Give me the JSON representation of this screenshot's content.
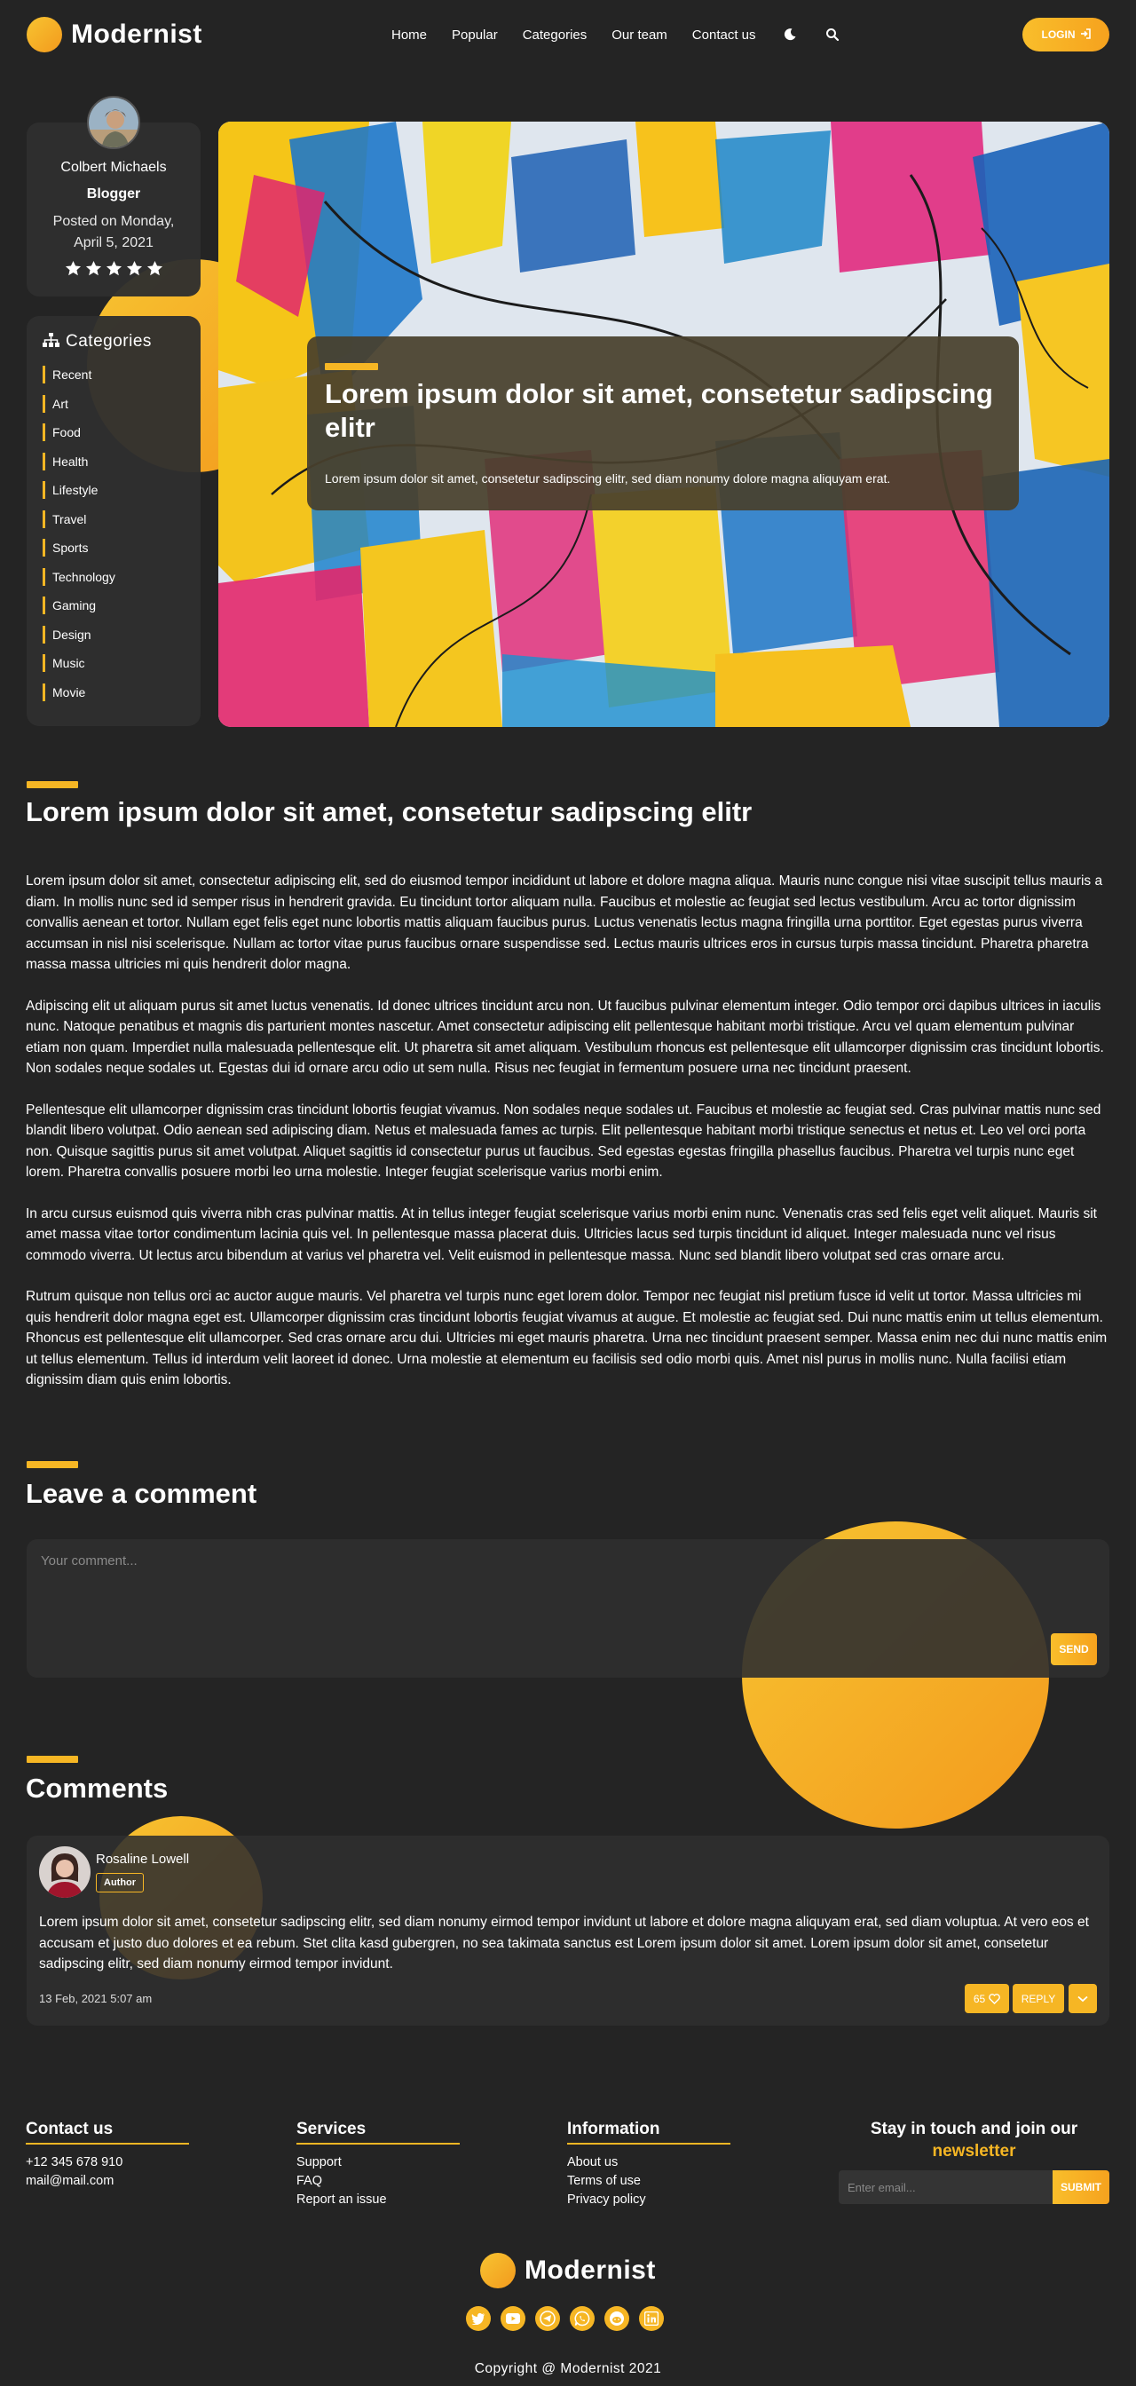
{
  "header": {
    "brand": "Modernist",
    "nav": [
      "Home",
      "Popular",
      "Categories",
      "Our team",
      "Contact us"
    ],
    "login_label": "LOGIN"
  },
  "author": {
    "name": "Colbert Michaels",
    "role": "Blogger",
    "posted_line1": "Posted on Monday,",
    "posted_line2": "April 5, 2021",
    "stars": 5
  },
  "categories": {
    "title": "Categories",
    "items": [
      "Recent",
      "Art",
      "Food",
      "Health",
      "Lifestyle",
      "Travel",
      "Sports",
      "Technology",
      "Gaming",
      "Design",
      "Music",
      "Movie"
    ]
  },
  "hero": {
    "title": "Lorem ipsum dolor sit amet, consetetur sadipscing elitr",
    "subtitle": "Lorem ipsum dolor sit amet, consetetur sadipscing elitr, sed diam nonumy dolore magna aliquyam erat."
  },
  "article": {
    "title": "Lorem ipsum dolor sit amet, consetetur sadipscing elitr",
    "paragraphs": [
      "Lorem ipsum dolor sit amet, consectetur adipiscing elit, sed do eiusmod tempor incididunt ut labore et dolore magna aliqua. Mauris nunc congue nisi vitae suscipit tellus mauris a diam. In mollis nunc sed id semper risus in hendrerit gravida. Eu tincidunt tortor aliquam nulla. Faucibus et molestie ac feugiat sed lectus vestibulum. Arcu ac tortor dignissim convallis aenean et tortor. Nullam eget felis eget nunc lobortis mattis aliquam faucibus purus. Luctus venenatis lectus magna fringilla urna porttitor. Eget egestas purus viverra accumsan in nisl nisi scelerisque. Nullam ac tortor vitae purus faucibus ornare suspendisse sed. Lectus mauris ultrices eros in cursus turpis massa tincidunt. Pharetra pharetra massa massa ultricies mi quis hendrerit dolor magna.",
      "Adipiscing elit ut aliquam purus sit amet luctus venenatis. Id donec ultrices tincidunt arcu non. Ut faucibus pulvinar elementum integer. Odio tempor orci dapibus ultrices in iaculis nunc. Natoque penatibus et magnis dis parturient montes nascetur. Amet consectetur adipiscing elit pellentesque habitant morbi tristique. Arcu vel quam elementum pulvinar etiam non quam. Imperdiet nulla malesuada pellentesque elit. Ut pharetra sit amet aliquam. Vestibulum rhoncus est pellentesque elit ullamcorper dignissim cras tincidunt lobortis. Non sodales neque sodales ut. Egestas dui id ornare arcu odio ut sem nulla. Risus nec feugiat in fermentum posuere urna nec tincidunt praesent.",
      "Pellentesque elit ullamcorper dignissim cras tincidunt lobortis feugiat vivamus. Non sodales neque sodales ut. Faucibus et molestie ac feugiat sed. Cras pulvinar mattis nunc sed blandit libero volutpat. Odio aenean sed adipiscing diam. Netus et malesuada fames ac turpis. Elit pellentesque habitant morbi tristique senectus et netus et. Leo vel orci porta non. Quisque sagittis purus sit amet volutpat. Aliquet sagittis id consectetur purus ut faucibus. Sed egestas egestas fringilla phasellus faucibus. Pharetra vel turpis nunc eget lorem. Pharetra convallis posuere morbi leo urna molestie. Integer feugiat scelerisque varius morbi enim.",
      "In arcu cursus euismod quis viverra nibh cras pulvinar mattis. At in tellus integer feugiat scelerisque varius morbi enim nunc. Venenatis cras sed felis eget velit aliquet. Mauris sit amet massa vitae tortor condimentum lacinia quis vel. In pellentesque massa placerat duis. Ultricies lacus sed turpis tincidunt id aliquet. Integer malesuada nunc vel risus commodo viverra. Ut lectus arcu bibendum at varius vel pharetra vel. Velit euismod in pellentesque massa. Nunc sed blandit libero volutpat sed cras ornare arcu.",
      "Rutrum quisque non tellus orci ac auctor augue mauris. Vel pharetra vel turpis nunc eget lorem dolor. Tempor nec feugiat nisl pretium fusce id velit ut tortor. Massa ultricies mi quis hendrerit dolor magna eget est. Ullamcorper dignissim cras tincidunt lobortis feugiat vivamus at augue. Et molestie ac feugiat sed. Dui nunc mattis enim ut tellus elementum. Rhoncus est pellentesque elit ullamcorper. Sed cras ornare arcu dui. Ultricies mi eget mauris pharetra. Urna nec tincidunt praesent semper. Massa enim nec dui nunc mattis enim ut tellus elementum. Tellus id interdum velit laoreet id donec. Urna molestie at elementum eu facilisis sed odio morbi quis. Amet nisl purus in mollis nunc. Nulla facilisi etiam dignissim diam quis enim lobortis."
    ]
  },
  "comment_form": {
    "title": "Leave a comment",
    "placeholder": "Your comment...",
    "send_label": "SEND"
  },
  "comments": {
    "title": "Comments",
    "items": [
      {
        "name": "Rosaline Lowell",
        "badge": "Author",
        "text": "Lorem ipsum dolor sit amet, consetetur sadipscing elitr, sed diam nonumy eirmod tempor invidunt ut labore et dolore magna aliquyam erat, sed diam voluptua. At vero eos et accusam et justo duo dolores et ea rebum. Stet clita kasd gubergren, no sea takimata sanctus est Lorem ipsum dolor sit amet. Lorem ipsum dolor sit amet, consetetur sadipscing elitr, sed diam nonumy eirmod tempor invidunt.",
        "date": "13 Feb, 2021 5:07 am",
        "likes": "65",
        "reply_label": "REPLY"
      }
    ]
  },
  "footer": {
    "contact": {
      "title": "Contact us",
      "lines": [
        "+12 345 678 910",
        "mail@mail.com"
      ]
    },
    "services": {
      "title": "Services",
      "lines": [
        "Support",
        "FAQ",
        "Report an issue"
      ]
    },
    "information": {
      "title": "Information",
      "lines": [
        "About us",
        "Terms of use",
        "Privacy policy"
      ]
    },
    "newsletter": {
      "title_line1": "Stay in touch and join our",
      "title_highlight": "newsletter",
      "placeholder": "Enter email...",
      "submit_label": "SUBMIT"
    },
    "brand": "Modernist",
    "socials": [
      "twitter-icon",
      "youtube-icon",
      "telegram-icon",
      "whatsapp-icon",
      "reddit-icon",
      "linkedin-icon"
    ],
    "copyright": "Copyright @ Modernist 2021"
  },
  "colors": {
    "background": "#242424",
    "panel": "#2f2f2f",
    "accent": "#f6b624",
    "accent_dark": "#f39a1d"
  }
}
